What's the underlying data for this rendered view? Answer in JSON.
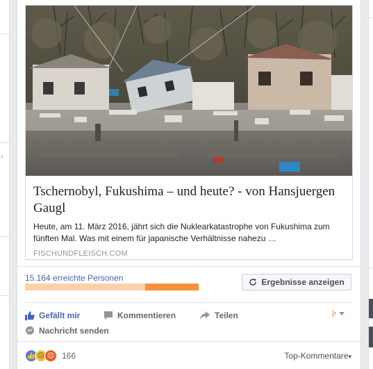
{
  "post": {
    "link": {
      "title": "Tschernobyl, Fukushima – und heute? - von Hansjuergen Gaugl",
      "description": "Heute, am 11. März 2016, jährt sich die Nuklearkatastrophe von Fukushima zum fünften Mal. Was mit einem für japanische Verhältnisse nahezu …",
      "domain": "FISCHUNDFLEISCH.COM"
    },
    "insights": {
      "reach_label": "15.164 erreichte Personen",
      "organic_fraction": 0.69,
      "results_button": "Ergebnisse anzeigen"
    },
    "actions": {
      "like": "Gefällt mir",
      "comment": "Kommentieren",
      "share": "Teilen",
      "send_message": "Nachricht senden"
    },
    "reactions": {
      "count": "166",
      "types": [
        "like",
        "sad",
        "angry"
      ]
    },
    "comments_sort": "Top-Kommentare",
    "colors": {
      "link_blue": "#4267b2",
      "bar_paid": "#f7923a",
      "bar_organic": "#fbd1ab"
    }
  }
}
